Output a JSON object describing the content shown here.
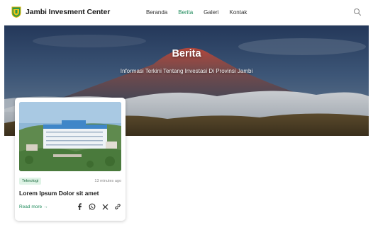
{
  "header": {
    "brand": "Jambi Invesment Center",
    "nav": [
      {
        "label": "Beranda",
        "active": false
      },
      {
        "label": "Berita",
        "active": true
      },
      {
        "label": "Galeri",
        "active": false
      },
      {
        "label": "Kontak",
        "active": false
      }
    ],
    "search_icon": "search-icon"
  },
  "hero": {
    "title": "Berita",
    "subtitle": "Informasi Terkini Tentang Investasi Di Provinsi Jambi"
  },
  "card": {
    "category": "Teknologi",
    "time": "13 minutes ago",
    "title": "Lorem Ipsum Dolor sit amet",
    "read_more": "Read more →",
    "share_icons": [
      "facebook-icon",
      "whatsapp-icon",
      "x-icon",
      "link-icon"
    ]
  },
  "colors": {
    "accent": "#1d8a5a",
    "badge_bg": "#dff3e6"
  }
}
